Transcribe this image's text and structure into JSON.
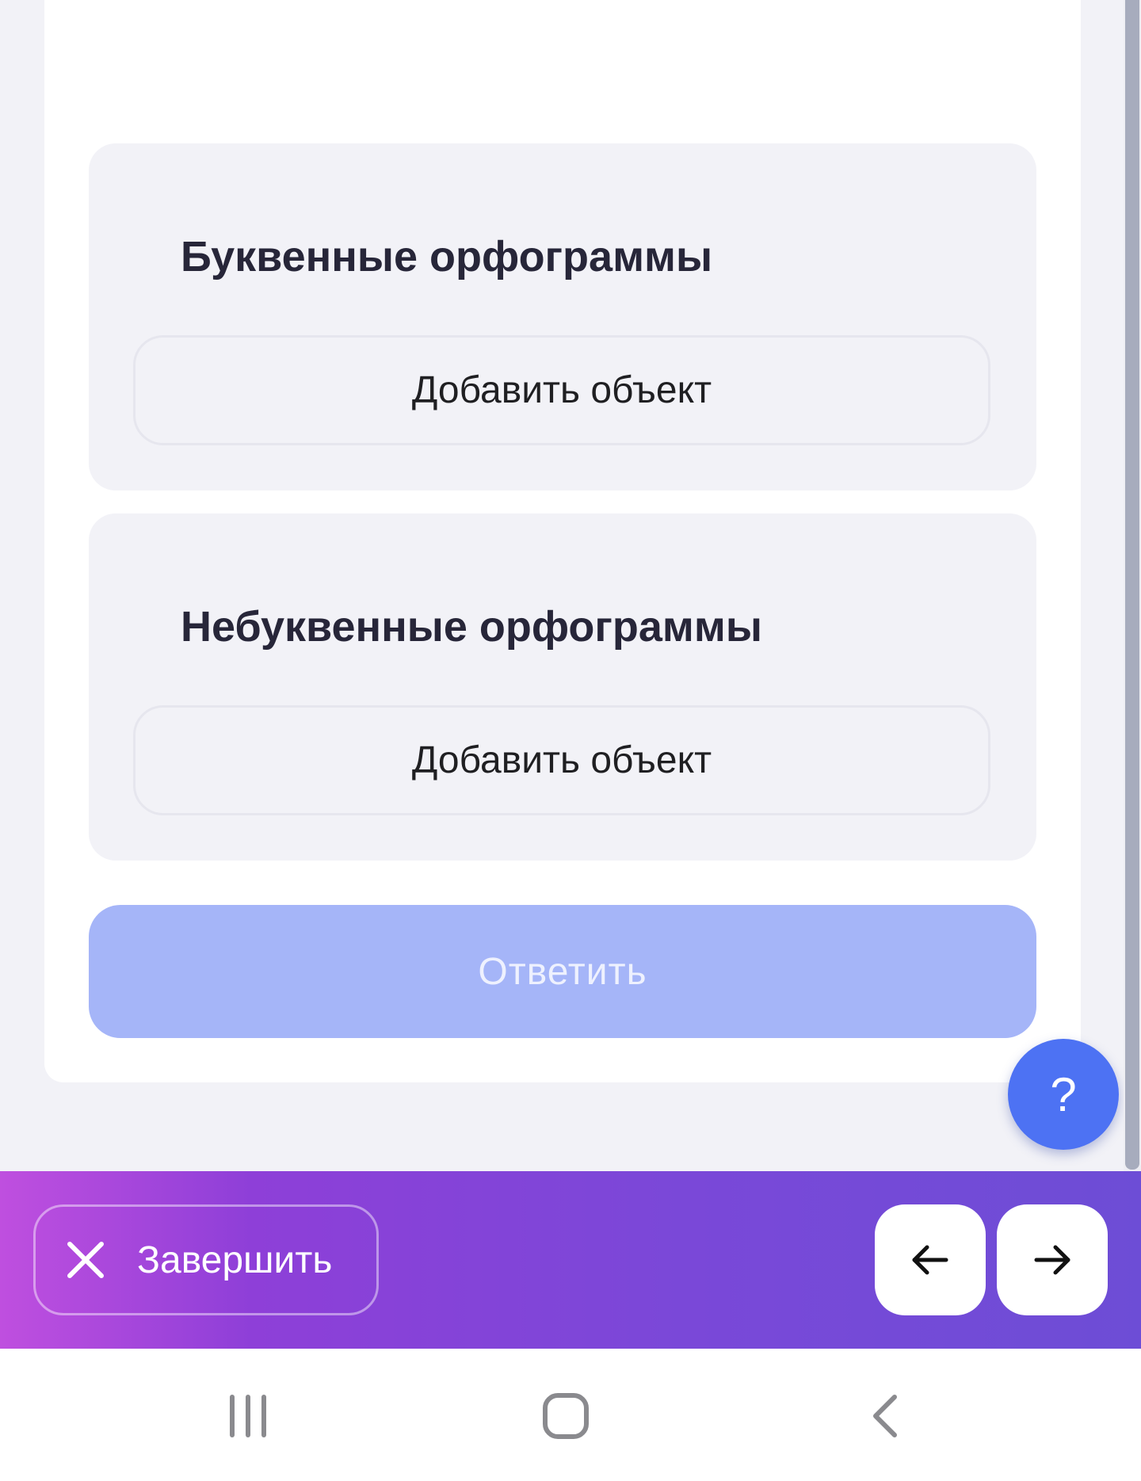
{
  "groups": [
    {
      "title": "Буквенные орфограммы",
      "add_label": "Добавить объект"
    },
    {
      "title": "Небуквенные орфограммы",
      "add_label": "Добавить объект"
    }
  ],
  "answer_button": {
    "label": "Ответить",
    "state": "disabled"
  },
  "help_button": {
    "label": "?"
  },
  "bottom_bar": {
    "finish_label": "Завершить",
    "prev_icon": "arrow-left-icon",
    "next_icon": "arrow-right-icon"
  },
  "system_nav": {
    "recents_icon": "recent-apps-icon",
    "home_icon": "home-icon",
    "back_icon": "back-icon"
  },
  "colors": {
    "accent": "#4d72f3",
    "answer_disabled": "#a5b5f8",
    "bar_gradient_start": "#bf4fdf",
    "bar_gradient_end": "#6d4dd6",
    "title_text": "#272639"
  }
}
